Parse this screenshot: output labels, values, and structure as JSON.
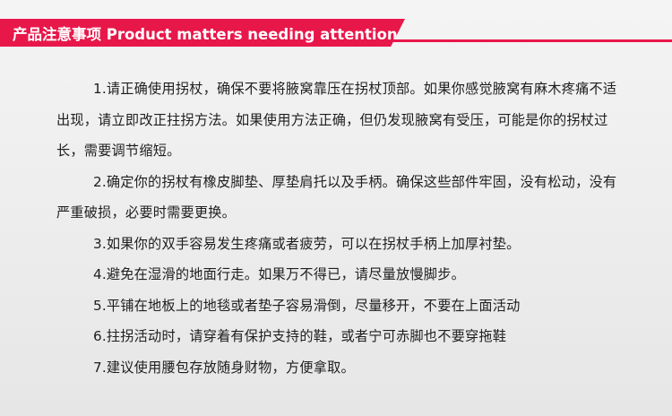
{
  "header": {
    "title": "产品注意事项 Product matters needing attention",
    "accent_color": "#e8174a"
  },
  "items": [
    "1.请正确使用拐杖，确保不要将腋窝靠压在拐杖顶部。如果你感觉腋窝有麻木疼痛不适出现，请立即改正拄拐方法。如果使用方法正确，但仍发现腋窝有受压，可能是你的拐杖过长，需要调节缩短。",
    "2.确定你的拐杖有橡皮脚垫、厚垫肩托以及手柄。确保这些部件牢固，没有松动，没有严重破损，必要时需要更换。",
    "3.如果你的双手容易发生疼痛或者疲劳，可以在拐杖手柄上加厚衬垫。",
    "4.避免在湿滑的地面行走。如果万不得已，请尽量放慢脚步。",
    "5.平铺在地板上的地毯或者垫子容易滑倒，尽量移开，不要在上面活动",
    "6.拄拐活动时，请穿着有保护支持的鞋，或者宁可赤脚也不要穿拖鞋",
    "7.建议使用腰包存放随身财物，方便拿取。"
  ]
}
